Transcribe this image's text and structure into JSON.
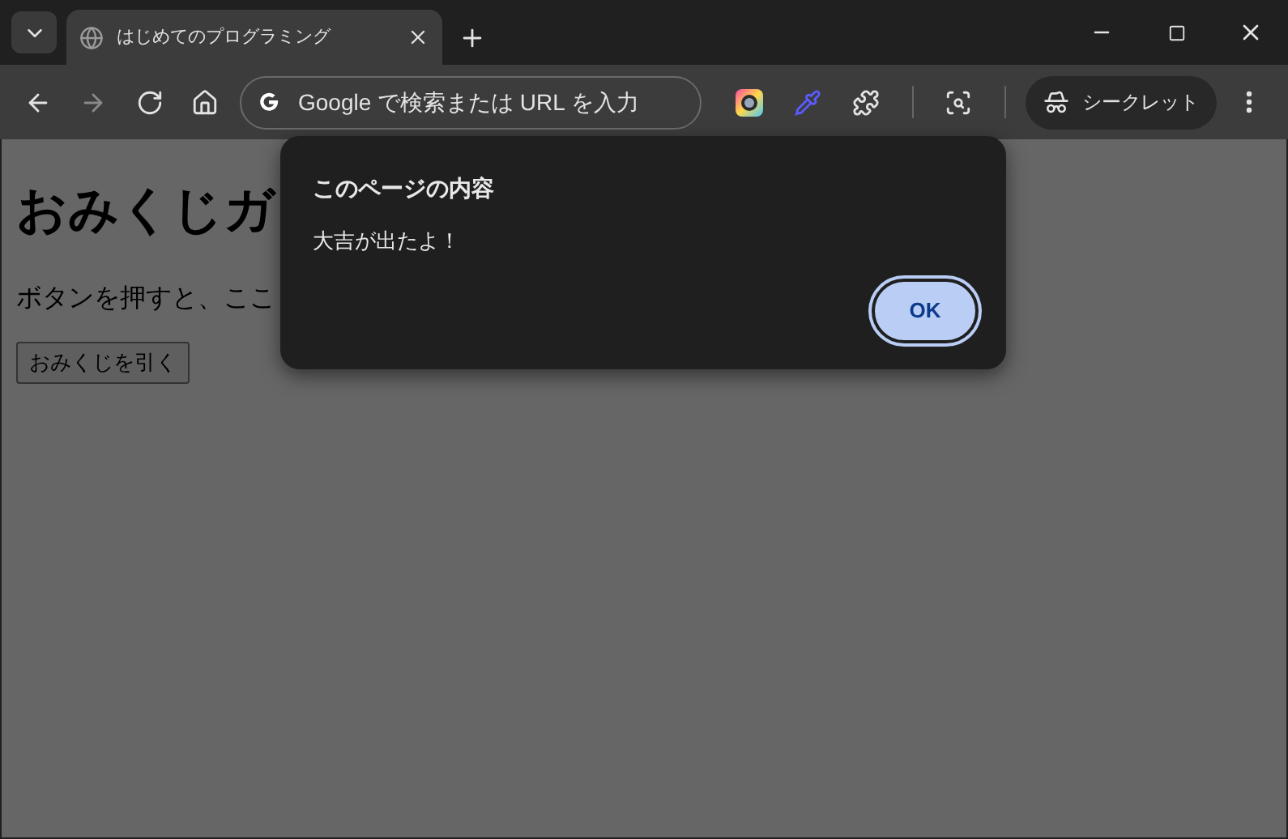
{
  "tab_strip": {
    "tabs": [
      {
        "title": "はじめてのプログラミング",
        "selected": true
      }
    ]
  },
  "toolbar": {
    "address_placeholder": "Google で検索または URL を入力",
    "profile_label": "シークレット"
  },
  "page": {
    "heading": "おみくじガ",
    "paragraph": "ボタンを押すと、ここ",
    "button": "おみくじを引く"
  },
  "dialog": {
    "title": "このページの内容",
    "message": "大吉が出たよ！",
    "buttons": [
      "OK"
    ]
  }
}
